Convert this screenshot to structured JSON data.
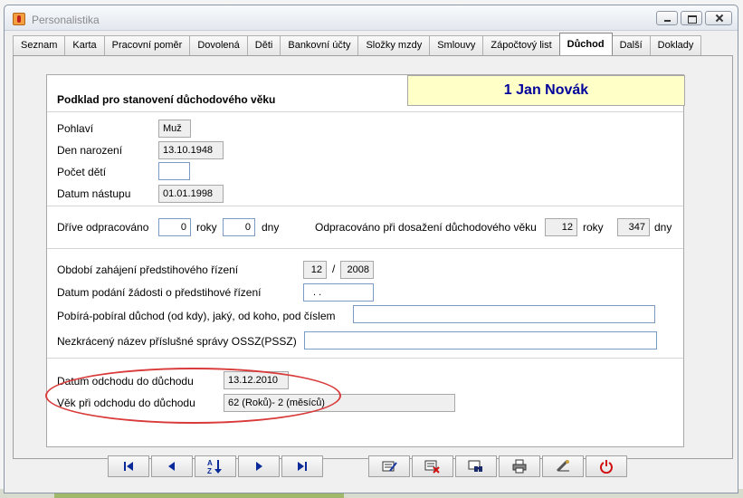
{
  "window": {
    "title": "Personalistika"
  },
  "tabs": [
    {
      "label": "Seznam",
      "active": false
    },
    {
      "label": "Karta",
      "active": false
    },
    {
      "label": "Pracovní poměr",
      "active": false
    },
    {
      "label": "Dovolená",
      "active": false
    },
    {
      "label": "Děti",
      "active": false
    },
    {
      "label": "Bankovní účty",
      "active": false
    },
    {
      "label": "Složky mzdy",
      "active": false
    },
    {
      "label": "Smlouvy",
      "active": false
    },
    {
      "label": "Zápočtový list",
      "active": false
    },
    {
      "label": "Důchod",
      "active": true
    },
    {
      "label": "Další",
      "active": false
    },
    {
      "label": "Doklady",
      "active": false
    }
  ],
  "form": {
    "heading": "Podklad pro stanovení důchodového věku",
    "employee_name": "1 Jan Novák",
    "pohlavi_label": "Pohlaví",
    "pohlavi_value": "Muž",
    "den_narozeni_label": "Den narození",
    "den_narozeni_value": "13.10.1948",
    "pocet_deti_label": "Počet dětí",
    "pocet_deti_value": "",
    "datum_nastupu_label": "Datum nástupu",
    "datum_nastupu_value": "01.01.1998",
    "drive_label": "Dříve odpracováno",
    "drive_roky": "0",
    "roky_label": "roky",
    "drive_dny": "0",
    "dny_label": "dny",
    "odpracovano_label": "Odpracováno při dosažení důchodového věku",
    "odpracovano_roky": "12",
    "odpracovano_dny": "347",
    "obdobi_label": "Období zahájení předstihového řízení",
    "obdobi_mesic": "12",
    "obdobi_slash": "/",
    "obdobi_rok": "2008",
    "datum_podani_label": "Datum podání žádosti o předstihové řízení",
    "datum_podani_value": " . .",
    "pobira_label": "Pobírá-pobíral důchod (od kdy), jaký, od koho, pod číslem",
    "pobira_value": "",
    "nazev_label": "Nezkrácený název příslušné správy OSSZ(PSSZ)",
    "nazev_value": "",
    "datum_odchodu_label": "Datum odchodu do důchodu",
    "datum_odchodu_value": "13.12.2010",
    "vek_label": "Věk při odchodu do důchodu",
    "vek_value": "62 (Roků)- 2 (měsíců)"
  },
  "toolbar": {
    "nav": [
      "first-record-icon",
      "previous-record-icon",
      "sort-az-icon",
      "next-record-icon",
      "last-record-icon"
    ],
    "actions": [
      "edit-record-icon",
      "delete-record-icon",
      "find-record-icon",
      "print-icon",
      "tools-icon",
      "power-icon"
    ]
  }
}
